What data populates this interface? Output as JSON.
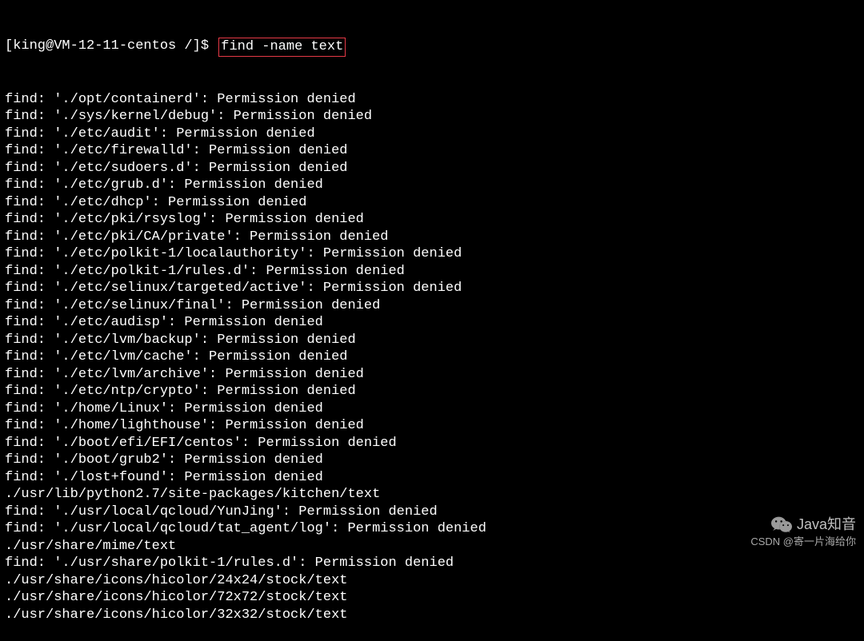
{
  "prompt": "[king@VM-12-11-centos /]$ ",
  "command": "find -name text",
  "lines": [
    "find: './opt/containerd': Permission denied",
    "find: './sys/kernel/debug': Permission denied",
    "find: './etc/audit': Permission denied",
    "find: './etc/firewalld': Permission denied",
    "find: './etc/sudoers.d': Permission denied",
    "find: './etc/grub.d': Permission denied",
    "find: './etc/dhcp': Permission denied",
    "find: './etc/pki/rsyslog': Permission denied",
    "find: './etc/pki/CA/private': Permission denied",
    "find: './etc/polkit-1/localauthority': Permission denied",
    "find: './etc/polkit-1/rules.d': Permission denied",
    "find: './etc/selinux/targeted/active': Permission denied",
    "find: './etc/selinux/final': Permission denied",
    "find: './etc/audisp': Permission denied",
    "find: './etc/lvm/backup': Permission denied",
    "find: './etc/lvm/cache': Permission denied",
    "find: './etc/lvm/archive': Permission denied",
    "find: './etc/ntp/crypto': Permission denied",
    "find: './home/Linux': Permission denied",
    "find: './home/lighthouse': Permission denied",
    "find: './boot/efi/EFI/centos': Permission denied",
    "find: './boot/grub2': Permission denied",
    "find: './lost+found': Permission denied",
    "./usr/lib/python2.7/site-packages/kitchen/text",
    "find: './usr/local/qcloud/YunJing': Permission denied",
    "find: './usr/local/qcloud/tat_agent/log': Permission denied",
    "./usr/share/mime/text",
    "find: './usr/share/polkit-1/rules.d': Permission denied",
    "./usr/share/icons/hicolor/24x24/stock/text",
    "./usr/share/icons/hicolor/72x72/stock/text",
    "./usr/share/icons/hicolor/32x32/stock/text"
  ],
  "watermark": {
    "brand": "Java知音",
    "credit": "CSDN @寄一片海给你"
  }
}
